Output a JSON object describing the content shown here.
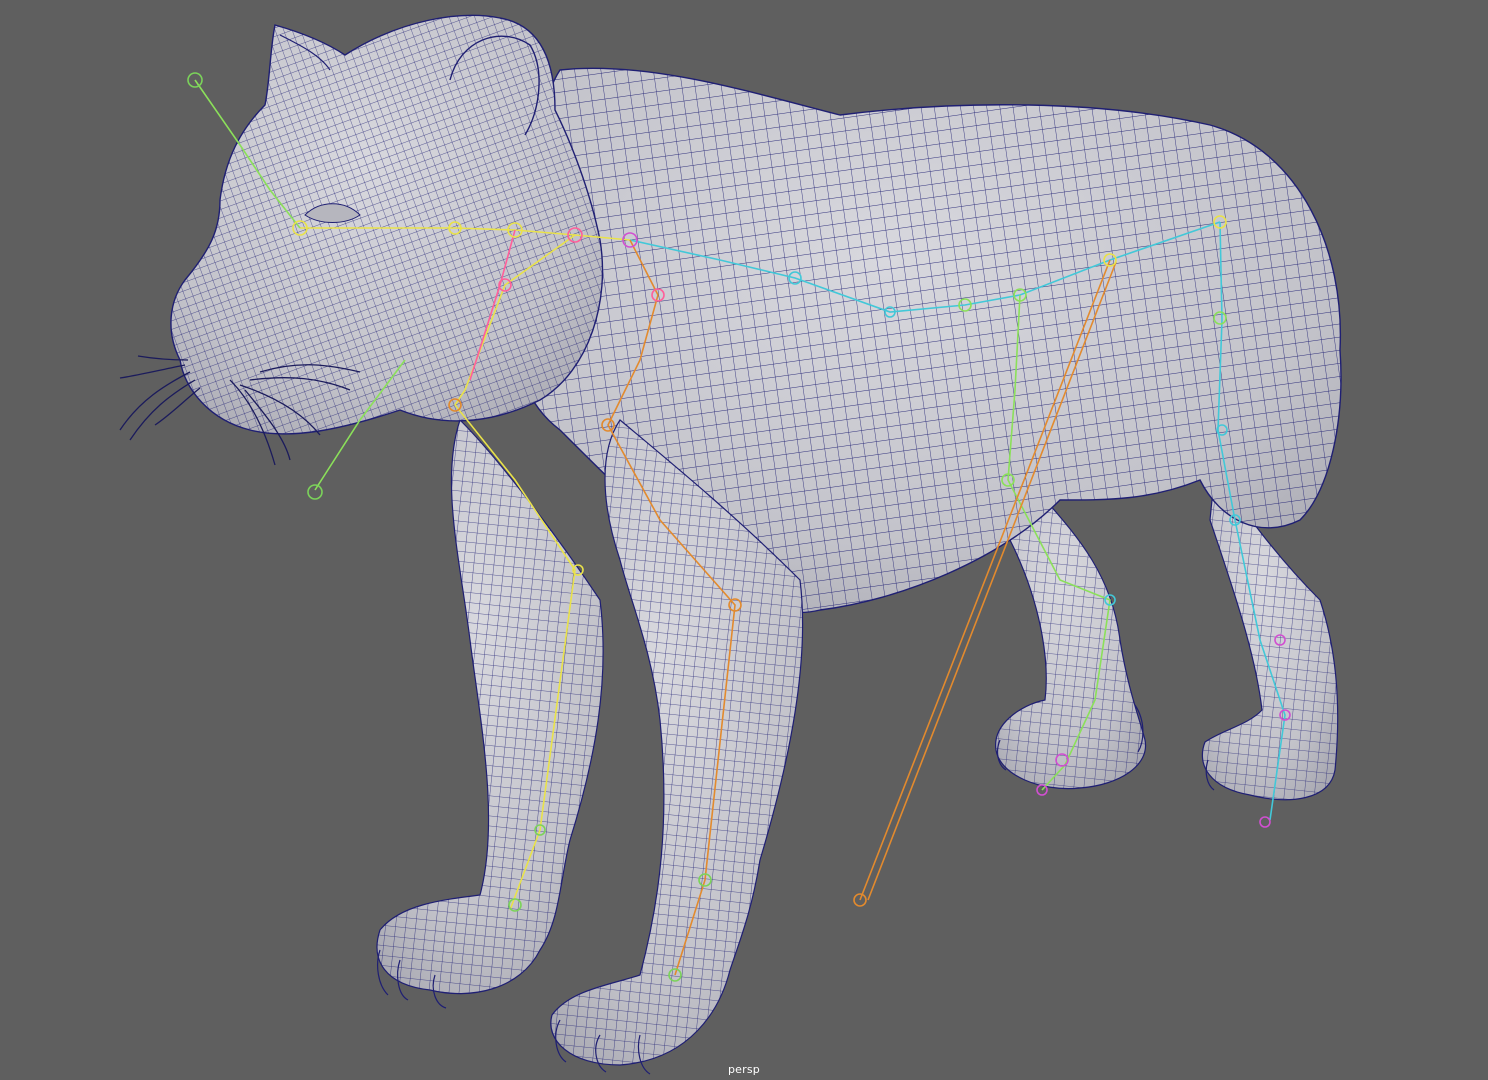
{
  "viewport": {
    "camera_name": "persp",
    "background_color": "#5f5f5f",
    "mesh_color": "#c9c9cf",
    "wireframe_color": "#1f1f73",
    "joint_colors": [
      "#e9e24a",
      "#d14fd1",
      "#ff5f9a",
      "#42c8d8",
      "#8be05a",
      "#e28a2e",
      "#7bd35a"
    ]
  }
}
